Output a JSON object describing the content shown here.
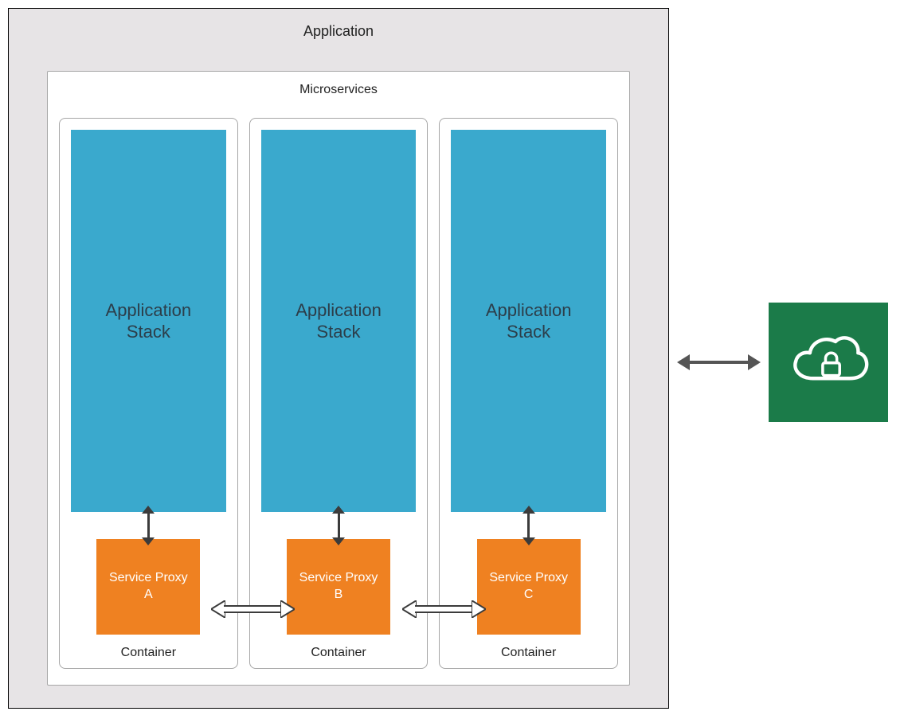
{
  "diagram": {
    "application_label": "Application",
    "microservices_label": "Microservices",
    "containers": [
      {
        "stack_label": "Application\nStack",
        "proxy_label": "Service Proxy\nA",
        "container_label": "Container"
      },
      {
        "stack_label": "Application\nStack",
        "proxy_label": "Service Proxy\nB",
        "container_label": "Container"
      },
      {
        "stack_label": "Application\nStack",
        "proxy_label": "Service Proxy\nC",
        "container_label": "Container"
      }
    ],
    "cloud_service_icon": "cloud-lock"
  },
  "colors": {
    "outer_bg": "#e7e4e6",
    "stack": "#3aa9cd",
    "proxy": "#ef8121",
    "cloud": "#1b7b49"
  }
}
